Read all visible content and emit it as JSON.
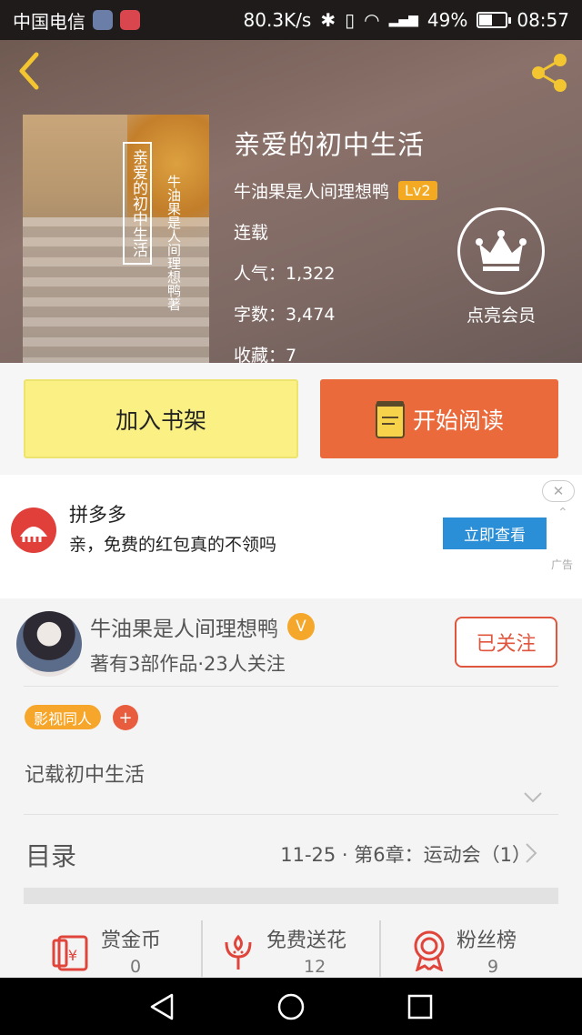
{
  "status_bar": {
    "carrier": "中国电信",
    "speed": "80.3K/s",
    "network": "4G",
    "battery": "49%",
    "battery_level": 0.49,
    "time": "08:57"
  },
  "header": {
    "back_icon": "chevron-left-icon",
    "share_icon": "share-icon",
    "accent_color": "#f2c531"
  },
  "book": {
    "cover_title": "亲爱的初中生活",
    "cover_author": "牛油果是人间理想鸭著",
    "title": "亲爱的初中生活",
    "author": "牛油果是人间理想鸭",
    "author_level": "Lv2",
    "status": "连载",
    "popularity_label": "人气：",
    "popularity": "1,322",
    "word_count_label": "字数：",
    "word_count": "3,474",
    "favorites_label": "收藏：",
    "favorites": "7"
  },
  "member": {
    "icon": "crown-icon",
    "label": "点亮会员"
  },
  "actions": {
    "add_shelf": "加入书架",
    "start_reading": "开始阅读",
    "read_icon": "book-icon"
  },
  "ad": {
    "brand": "拼多多",
    "text": "亲，免费的红包真的不领吗",
    "cta": "立即查看",
    "close": "✕",
    "label": "广告"
  },
  "author_card": {
    "name": "牛油果是人间理想鸭",
    "verified_badge": "V",
    "subtitle": "著有3部作品·23人关注",
    "follow_state": "已关注"
  },
  "tags": [
    "影视同人"
  ],
  "tag_add": "+",
  "description": "记载初中生活",
  "toc": {
    "label": "目录",
    "latest": "11-25 · 第6章：运动会（1）"
  },
  "stats": [
    {
      "icon": "red-envelope-icon",
      "label": "赏金币",
      "value": "0"
    },
    {
      "icon": "flower-icon",
      "label": "免费送花",
      "value": "12"
    },
    {
      "icon": "medal-icon",
      "label": "粉丝榜",
      "value": "9"
    }
  ],
  "nav": {
    "back": "back-triangle-icon",
    "home": "home-circle-icon",
    "recents": "recents-square-icon"
  }
}
